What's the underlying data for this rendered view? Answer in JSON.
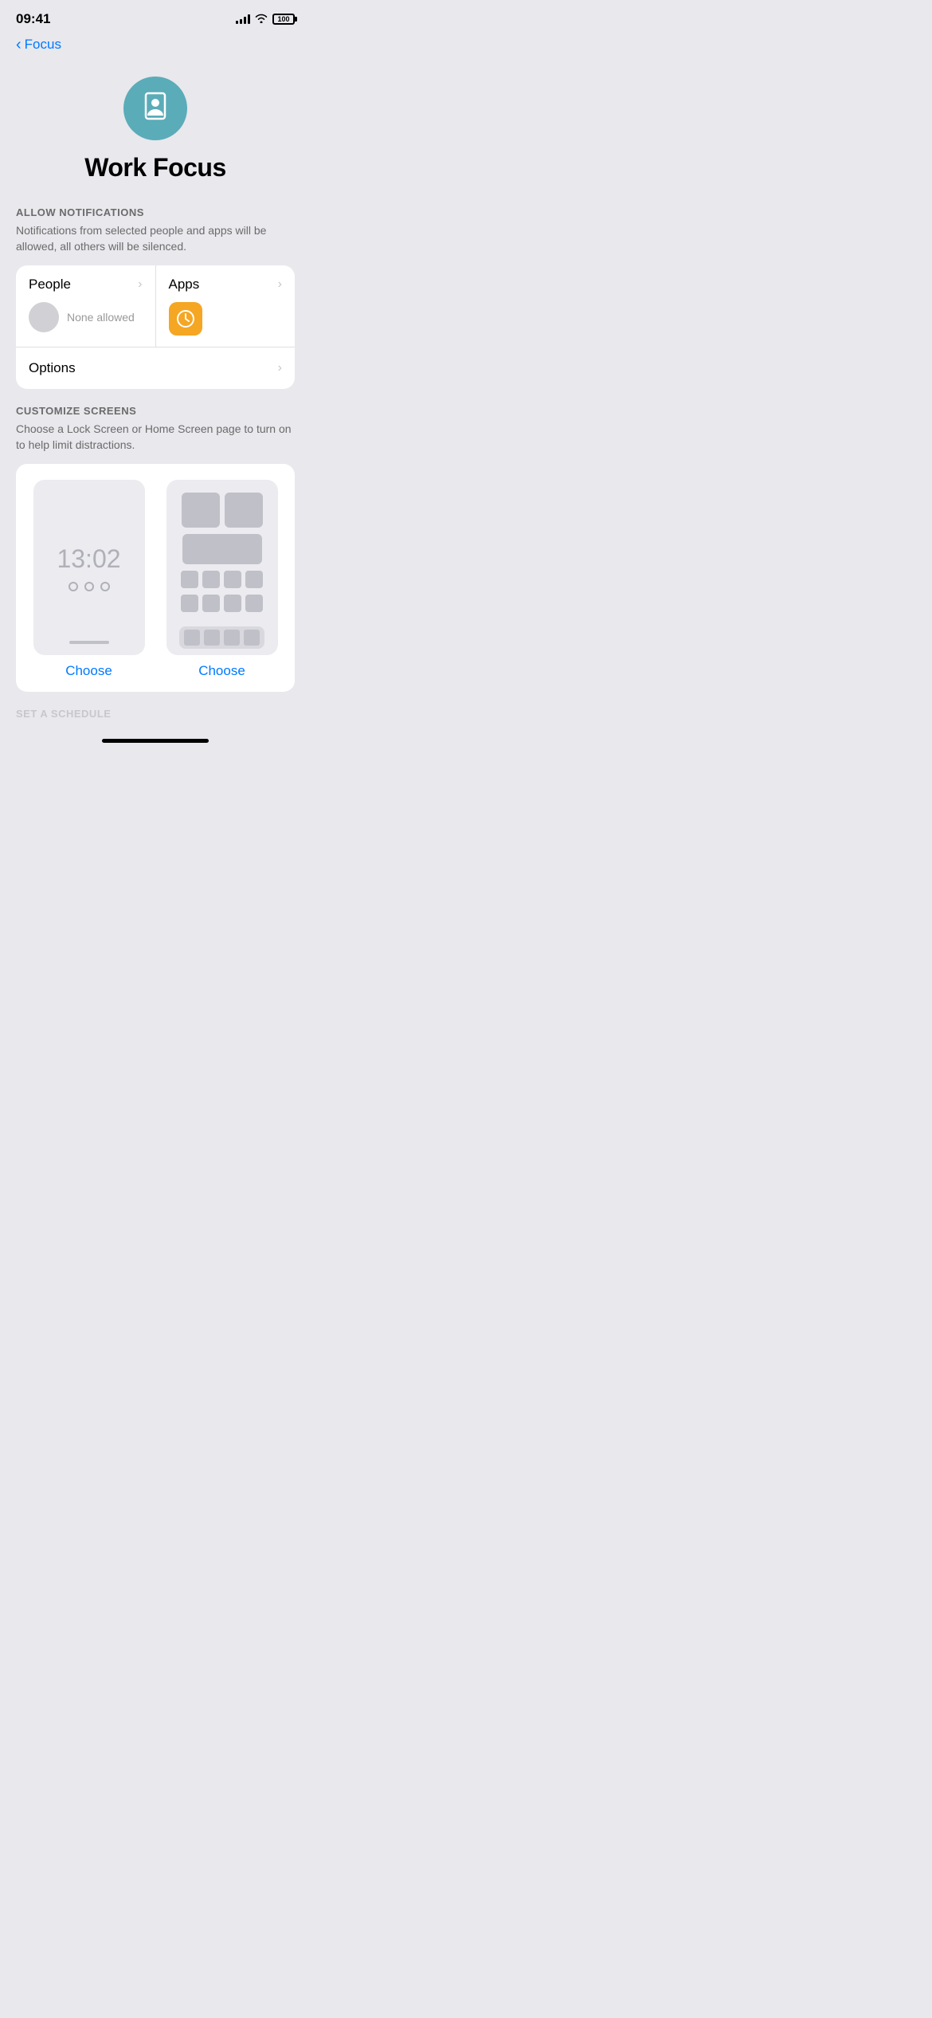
{
  "statusBar": {
    "time": "09:41",
    "battery": "100"
  },
  "nav": {
    "backLabel": "Focus"
  },
  "hero": {
    "title": "Work Focus",
    "iconSymbol": "🪪"
  },
  "allowNotifications": {
    "sectionLabel": "ALLOW NOTIFICATIONS",
    "description": "Notifications from selected people and apps will be allowed, all others will be silenced.",
    "people": {
      "title": "People",
      "noneAllowedText": "None allowed"
    },
    "apps": {
      "title": "Apps"
    },
    "options": {
      "title": "Options"
    }
  },
  "customizeScreens": {
    "sectionLabel": "CUSTOMIZE SCREENS",
    "description": "Choose a Lock Screen or Home Screen page to turn on to help limit distractions.",
    "lockScreen": {
      "time": "13:02",
      "chooseLabel": "Choose"
    },
    "homeScreen": {
      "chooseLabel": "Choose"
    }
  },
  "setSchedule": {
    "sectionLabel": "SET A SCHEDULE"
  },
  "chevronSymbol": "›"
}
